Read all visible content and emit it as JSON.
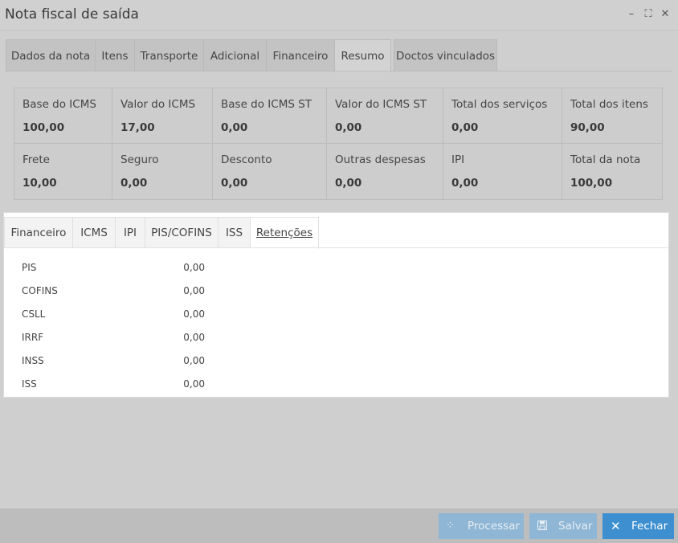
{
  "window": {
    "title": "Nota fiscal de saída",
    "controls": {
      "minimize": "–",
      "maximize": "⛶",
      "close": "✕"
    }
  },
  "main_tabs": [
    {
      "label": "Dados da nota"
    },
    {
      "label": "Itens"
    },
    {
      "label": "Transporte"
    },
    {
      "label": "Adicional"
    },
    {
      "label": "Financeiro"
    },
    {
      "label": "Resumo",
      "active": true
    },
    {
      "label": "Doctos vinculados"
    }
  ],
  "summary": {
    "row1": [
      {
        "label": "Base do ICMS",
        "value": "100,00"
      },
      {
        "label": "Valor do ICMS",
        "value": "17,00"
      },
      {
        "label": "Base do ICMS ST",
        "value": "0,00"
      },
      {
        "label": "Valor do ICMS ST",
        "value": "0,00"
      },
      {
        "label": "Total dos serviços",
        "value": "0,00"
      },
      {
        "label": "Total dos itens",
        "value": "90,00"
      }
    ],
    "row2": [
      {
        "label": "Frete",
        "value": "10,00"
      },
      {
        "label": "Seguro",
        "value": "0,00"
      },
      {
        "label": "Desconto",
        "value": "0,00"
      },
      {
        "label": "Outras despesas",
        "value": "0,00"
      },
      {
        "label": "IPI",
        "value": "0,00"
      },
      {
        "label": "Total da nota",
        "value": "100,00"
      }
    ]
  },
  "sub_tabs": [
    {
      "label": "Financeiro"
    },
    {
      "label": "ICMS"
    },
    {
      "label": "IPI"
    },
    {
      "label": "PIS/COFINS"
    },
    {
      "label": "ISS"
    },
    {
      "label": "Retenções",
      "active": true
    }
  ],
  "retencoes": [
    {
      "label": "PIS",
      "value": "0,00"
    },
    {
      "label": "COFINS",
      "value": "0,00"
    },
    {
      "label": "CSLL",
      "value": "0,00"
    },
    {
      "label": "IRRF",
      "value": "0,00"
    },
    {
      "label": "INSS",
      "value": "0,00"
    },
    {
      "label": "ISS",
      "value": "0,00"
    }
  ],
  "footer": {
    "processar": {
      "label": "Processar",
      "icon": "spinner-icon"
    },
    "salvar": {
      "label": "Salvar",
      "icon": "save-icon"
    },
    "fechar": {
      "label": "Fechar",
      "icon": "close-icon"
    }
  },
  "colors": {
    "primary_button": "#3d8fd0",
    "disabled_button": "#8fb6d4"
  }
}
